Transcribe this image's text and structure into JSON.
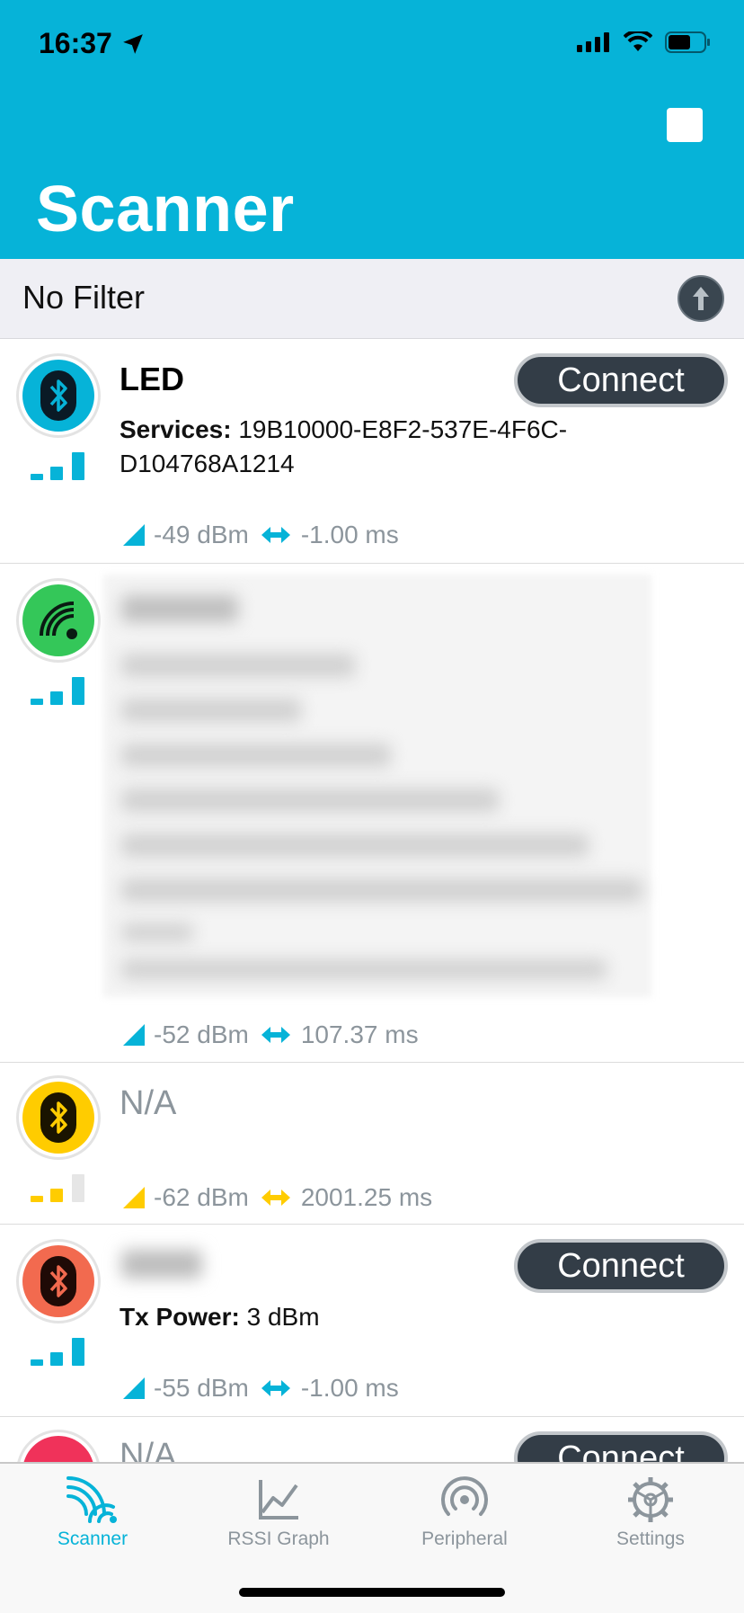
{
  "status_bar": {
    "time": "16:37"
  },
  "header": {
    "title": "Scanner",
    "accent": "#06b3d8"
  },
  "filter": {
    "label": "No Filter"
  },
  "devices": [
    {
      "name": "LED",
      "details_label": "Services:",
      "details_value": "19B10000-E8F2-537E-4F6C-",
      "details_value_2": "D104768A1214",
      "rssi": "-49 dBm",
      "interval": "-1.00 ms",
      "connect_label": "Connect",
      "avatar_color": "#06b3d8",
      "signal_bars": 3
    },
    {
      "rssi": "-52 dBm",
      "interval": "107.37 ms",
      "avatar_color": "#34c759",
      "signal_bars": 3
    },
    {
      "name": "N/A",
      "rssi": "-62 dBm",
      "interval": "2001.25 ms",
      "avatar_color": "#ffcc00",
      "signal_bars": 2
    },
    {
      "details_label": "Tx Power:",
      "details_value": "3 dBm",
      "rssi": "-55 dBm",
      "interval": "-1.00 ms",
      "connect_label": "Connect",
      "avatar_color": "#f26a4f",
      "signal_bars": 3
    },
    {
      "name": "N/A",
      "connect_label": "Connect",
      "avatar_color": "#f0325a"
    }
  ],
  "tabs": [
    {
      "label": "Scanner",
      "active": true,
      "icon": "scanner-icon"
    },
    {
      "label": "RSSI Graph",
      "active": false,
      "icon": "graph-icon"
    },
    {
      "label": "Peripheral",
      "active": false,
      "icon": "peripheral-icon"
    },
    {
      "label": "Settings",
      "active": false,
      "icon": "gear-icon"
    }
  ],
  "colors": {
    "inactive": "#8c959c",
    "active": "#06b3d8",
    "button_dark": "#333d47"
  }
}
